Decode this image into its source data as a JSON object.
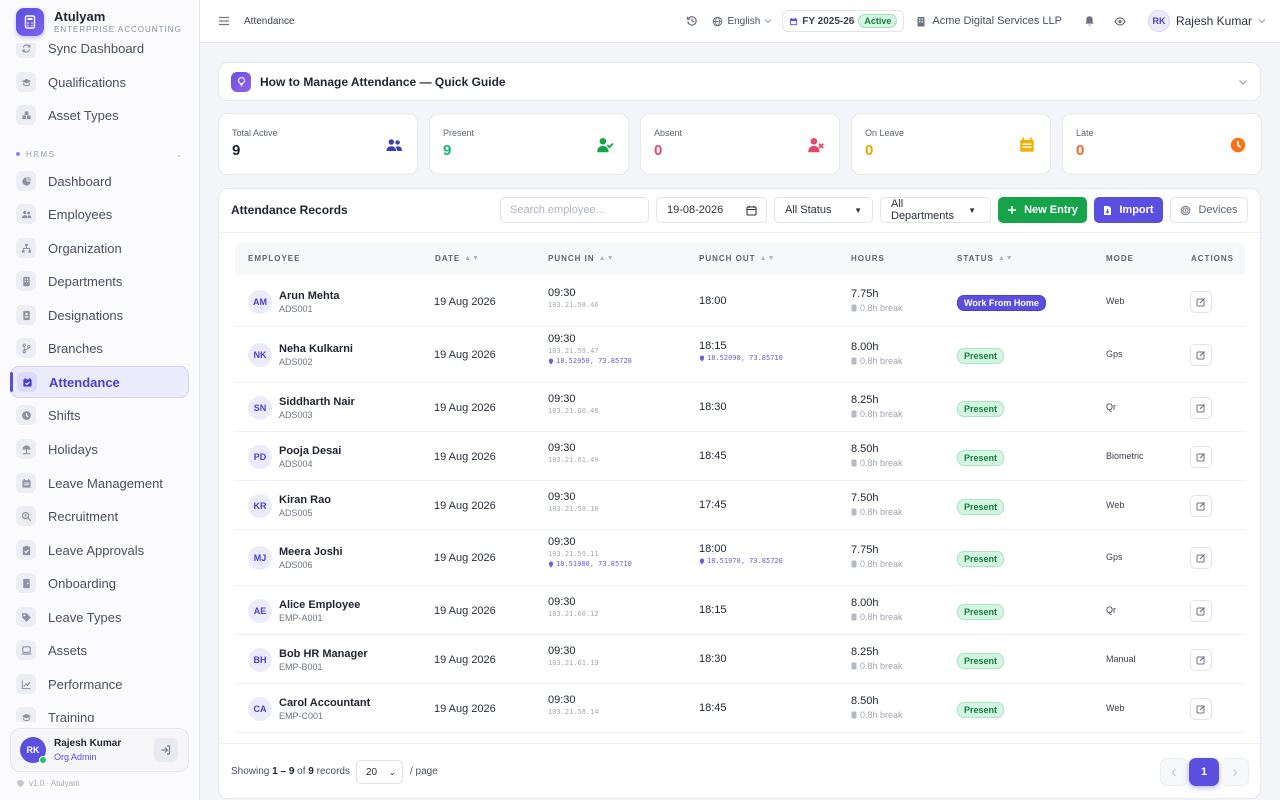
{
  "app": {
    "name": "Atulyam",
    "subtitle": "ENTERPRISE ACCOUNTING",
    "version": "v1.0 · Atulyam"
  },
  "sidebar": {
    "top_items": [
      {
        "label": "Sync Dashboard",
        "icon": "sync-icon"
      },
      {
        "label": "Qualifications",
        "icon": "graduation-cap-icon"
      },
      {
        "label": "Asset Types",
        "icon": "boxes-icon"
      }
    ],
    "section": "HRMS",
    "items": [
      {
        "label": "Dashboard",
        "icon": "pie-chart-icon"
      },
      {
        "label": "Employees",
        "icon": "users-icon"
      },
      {
        "label": "Organization",
        "icon": "sitemap-icon"
      },
      {
        "label": "Departments",
        "icon": "building-icon"
      },
      {
        "label": "Designations",
        "icon": "id-badge-icon"
      },
      {
        "label": "Branches",
        "icon": "branch-icon"
      },
      {
        "label": "Attendance",
        "icon": "calendar-check-icon",
        "active": true
      },
      {
        "label": "Shifts",
        "icon": "clock-icon"
      },
      {
        "label": "Holidays",
        "icon": "umbrella-beach-icon"
      },
      {
        "label": "Leave Management",
        "icon": "calendar-icon"
      },
      {
        "label": "Recruitment",
        "icon": "search-person-icon"
      },
      {
        "label": "Leave Approvals",
        "icon": "clipboard-check-icon"
      },
      {
        "label": "Onboarding",
        "icon": "door-icon"
      },
      {
        "label": "Leave Types",
        "icon": "tags-icon"
      },
      {
        "label": "Assets",
        "icon": "laptop-icon"
      },
      {
        "label": "Performance",
        "icon": "chart-line-icon"
      },
      {
        "label": "Training",
        "icon": "graduation-cap-icon"
      }
    ],
    "user": {
      "initials": "RK",
      "name": "Rajesh Kumar",
      "role": "Org Admin"
    }
  },
  "topbar": {
    "breadcrumb": "Attendance",
    "language": "English",
    "fy": "FY 2025-26",
    "fy_badge": "Active",
    "company": "Acme Digital Services LLP",
    "user_initials": "RK",
    "user_name": "Rajesh Kumar"
  },
  "guide": {
    "title": "How to Manage Attendance — Quick Guide"
  },
  "stats": [
    {
      "label": "Total Active",
      "value": "9",
      "color": "#1f2430",
      "icon": "users-icon",
      "icon_color": "#3b3fb5"
    },
    {
      "label": "Present",
      "value": "9",
      "color": "#16b47a",
      "icon": "user-check-icon",
      "icon_color": "#16a34a"
    },
    {
      "label": "Absent",
      "value": "0",
      "color": "#e54868",
      "icon": "user-x-icon",
      "icon_color": "#e54868"
    },
    {
      "label": "On Leave",
      "value": "0",
      "color": "#e0a800",
      "icon": "calendar-icon",
      "icon_color": "#eab308"
    },
    {
      "label": "Late",
      "value": "0",
      "color": "#f0672b",
      "icon": "clock-icon",
      "icon_color": "#f97316"
    }
  ],
  "records": {
    "title": "Attendance Records",
    "search_placeholder": "Search employee...",
    "date": "19-08-2026",
    "status_filter": "All Status",
    "dept_filter": "All Departments",
    "new_entry": "New Entry",
    "import": "Import",
    "devices": "Devices",
    "columns": [
      "EMPLOYEE",
      "DATE",
      "PUNCH IN",
      "PUNCH OUT",
      "HOURS",
      "STATUS",
      "MODE",
      "ACTIONS"
    ],
    "rows": [
      {
        "initials": "AM",
        "name": "Arun Mehta",
        "code": "ADS001",
        "date": "19 Aug 2026",
        "in": "09:30",
        "in_ip": "103.21.58.46",
        "in_geo": "",
        "out": "18:00",
        "out_geo": "",
        "hours": "7.75h",
        "break": "0.8h break",
        "status": "Work From Home",
        "status_type": "wfh",
        "mode": "Web"
      },
      {
        "initials": "NK",
        "name": "Neha Kulkarni",
        "code": "ADS002",
        "date": "19 Aug 2026",
        "in": "09:30",
        "in_ip": "103.21.59.47",
        "in_geo": "18.52050, 73.85720",
        "out": "18:15",
        "out_geo": "18.52090, 73.85710",
        "hours": "8.00h",
        "break": "0.8h break",
        "status": "Present",
        "status_type": "present",
        "mode": "Gps"
      },
      {
        "initials": "SN",
        "name": "Siddharth Nair",
        "code": "ADS003",
        "date": "19 Aug 2026",
        "in": "09:30",
        "in_ip": "103.21.60.48",
        "in_geo": "",
        "out": "18:30",
        "out_geo": "",
        "hours": "8.25h",
        "break": "0.8h break",
        "status": "Present",
        "status_type": "present",
        "mode": "Qr"
      },
      {
        "initials": "PD",
        "name": "Pooja Desai",
        "code": "ADS004",
        "date": "19 Aug 2026",
        "in": "09:30",
        "in_ip": "103.21.61.49",
        "in_geo": "",
        "out": "18:45",
        "out_geo": "",
        "hours": "8.50h",
        "break": "0.8h break",
        "status": "Present",
        "status_type": "present",
        "mode": "Biometric"
      },
      {
        "initials": "KR",
        "name": "Kiran Rao",
        "code": "ADS005",
        "date": "19 Aug 2026",
        "in": "09:30",
        "in_ip": "103.21.58.10",
        "in_geo": "",
        "out": "17:45",
        "out_geo": "",
        "hours": "7.50h",
        "break": "0.8h break",
        "status": "Present",
        "status_type": "present",
        "mode": "Web"
      },
      {
        "initials": "MJ",
        "name": "Meera Joshi",
        "code": "ADS006",
        "date": "19 Aug 2026",
        "in": "09:30",
        "in_ip": "103.21.59.11",
        "in_geo": "18.51980, 73.85710",
        "out": "18:00",
        "out_geo": "18.51970, 73.85720",
        "hours": "7.75h",
        "break": "0.8h break",
        "status": "Present",
        "status_type": "present",
        "mode": "Gps"
      },
      {
        "initials": "AE",
        "name": "Alice Employee",
        "code": "EMP-A001",
        "date": "19 Aug 2026",
        "in": "09:30",
        "in_ip": "103.21.60.12",
        "in_geo": "",
        "out": "18:15",
        "out_geo": "",
        "hours": "8.00h",
        "break": "0.8h break",
        "status": "Present",
        "status_type": "present",
        "mode": "Qr"
      },
      {
        "initials": "BH",
        "name": "Bob HR Manager",
        "code": "EMP-B001",
        "date": "19 Aug 2026",
        "in": "09:30",
        "in_ip": "103.21.61.13",
        "in_geo": "",
        "out": "18:30",
        "out_geo": "",
        "hours": "8.25h",
        "break": "0.8h break",
        "status": "Present",
        "status_type": "present",
        "mode": "Manual"
      },
      {
        "initials": "CA",
        "name": "Carol Accountant",
        "code": "EMP-C001",
        "date": "19 Aug 2026",
        "in": "09:30",
        "in_ip": "103.21.58.14",
        "in_geo": "",
        "out": "18:45",
        "out_geo": "",
        "hours": "8.50h",
        "break": "0.8h break",
        "status": "Present",
        "status_type": "present",
        "mode": "Web"
      }
    ],
    "footer": {
      "showing_prefix": "Showing",
      "range": "1 – 9",
      "of": "of",
      "total": "9",
      "records_word": "records",
      "per_page": "20",
      "per_page_suffix": "/ page",
      "current_page": "1"
    }
  }
}
